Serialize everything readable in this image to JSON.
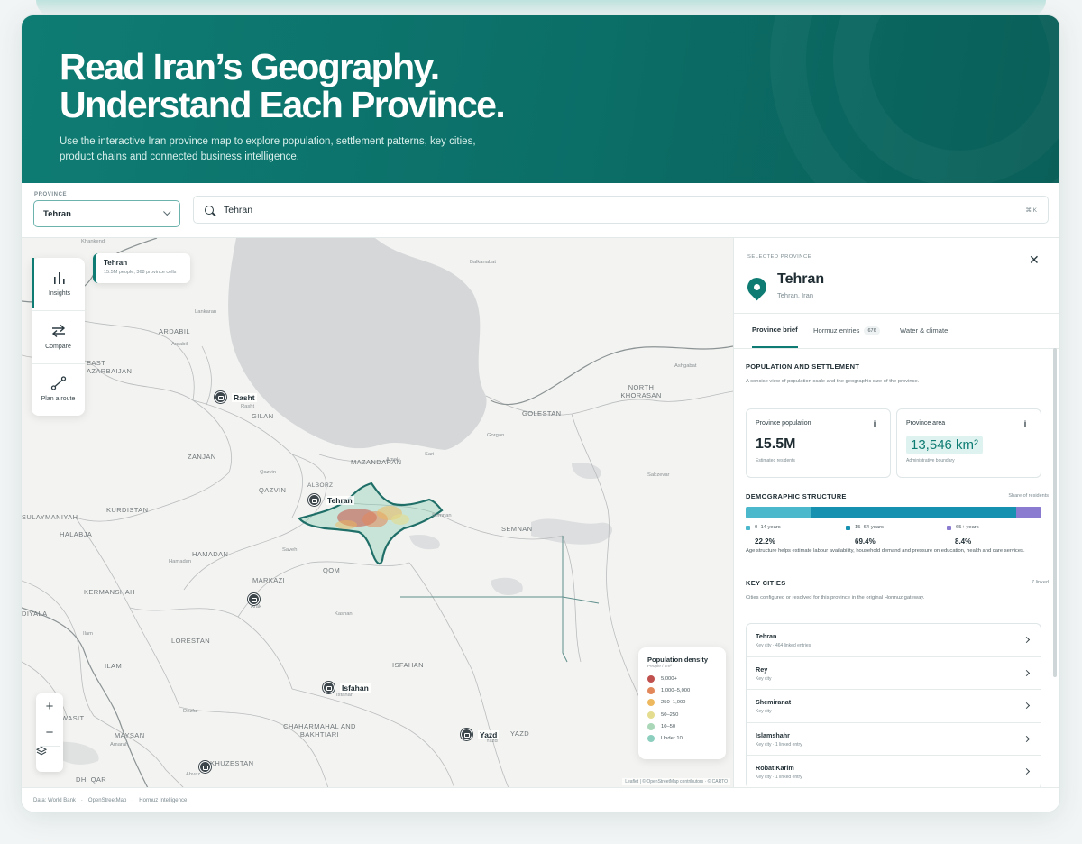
{
  "hero": {
    "title_line1": "Read Iran’s Geography.",
    "title_line2": "Understand Each Province.",
    "description": "Use the interactive Iran province map to explore population, settlement patterns, key cities, product chains and connected business intelligence."
  },
  "controls": {
    "province_label": "PROVINCE",
    "province_value": "Tehran",
    "search_value": "Tehran",
    "search_shortcut": "⌘ K"
  },
  "map": {
    "tools": [
      {
        "label": "Insights",
        "icon": "bar-chart-icon"
      },
      {
        "label": "Compare",
        "icon": "swap-arrows-icon"
      },
      {
        "label": "Plan a route",
        "icon": "route-icon"
      }
    ],
    "tooltip": {
      "title": "Tehran",
      "subtitle": "15.5M people, 368 province cells"
    },
    "regions": [
      "EAST AZARBAIJAN",
      "ARDABIL",
      "GILAN",
      "ZANJAN",
      "QAZVIN",
      "ALBORZ",
      "MAZANDARAN",
      "GOLESTAN",
      "NORTH KHORASAN",
      "KURDISTAN",
      "HAMADAN",
      "MARKAZI",
      "QOM",
      "SEMNAN",
      "KERMANSHAH",
      "LORESTAN",
      "ILAM",
      "ISFAHAN",
      "CHAHARMAHAL AND BAKHTIARI",
      "KHUZESTAN",
      "YAZD",
      "MAYSAN",
      "DHI QAR",
      "SULAYMANIYAH",
      "HALABJA",
      "DIYALA",
      "WASIT"
    ],
    "towns": [
      "Khankendi",
      "Lankaran",
      "Ardabil",
      "Rasht",
      "Balkanabat",
      "Ashgabat",
      "Gorgan",
      "Sari",
      "Amol",
      "Qazvin",
      "Semnan",
      "Sabzevar",
      "Saveh",
      "Hamadan",
      "Arak",
      "Kashan",
      "Ilam",
      "Dezful",
      "Isfahan",
      "Amarah",
      "Ahvaz",
      "Yazd"
    ],
    "labeled_cities": [
      "Rasht",
      "Tehran",
      "Isfahan",
      "Yazd"
    ],
    "zoom_in": "+",
    "zoom_out": "−",
    "legend": {
      "title": "Population density",
      "subtitle": "People / km²",
      "items": [
        {
          "label": "5,000+",
          "color": "#c0504d"
        },
        {
          "label": "1,000–5,000",
          "color": "#e2875a"
        },
        {
          "label": "250–1,000",
          "color": "#edb85e"
        },
        {
          "label": "50–250",
          "color": "#e4dc8e"
        },
        {
          "label": "10–50",
          "color": "#a9d7b8"
        },
        {
          "label": "Under 10",
          "color": "#8dcfbf"
        }
      ]
    },
    "attribution": "Leaflet | © OpenStreetMap contributors · © CARTO"
  },
  "panel": {
    "selected_label": "SELECTED PROVINCE",
    "title": "Tehran",
    "subtitle": "Tehran, Iran",
    "tabs": [
      {
        "label": "Province brief"
      },
      {
        "label": "Hormuz entries",
        "badge": "676"
      },
      {
        "label": "Water & climate"
      }
    ],
    "population": {
      "title": "POPULATION AND SETTLEMENT",
      "desc": "A concise view of population scale and the geographic size of the province.",
      "pop_label": "Province population",
      "pop_value": "15.5M",
      "pop_note": "Estimated residents",
      "area_label": "Province area",
      "area_value": "13,546 km²",
      "area_note": "Administrative boundary"
    },
    "demographics": {
      "title": "DEMOGRAPHIC STRUCTURE",
      "source": "Share of residents",
      "groups": [
        {
          "label": "0–14 years",
          "value": "22.2%",
          "share": 22.2,
          "color": "#4cb8cc"
        },
        {
          "label": "15–64 years",
          "value": "69.4%",
          "share": 69.4,
          "color": "#1691b0"
        },
        {
          "label": "65+ years",
          "value": "8.4%",
          "share": 8.4,
          "color": "#8a7ad0"
        }
      ],
      "note": "Age structure helps estimate labour availability, household demand and pressure on education, health and care services."
    },
    "cities": {
      "title": "KEY CITIES",
      "count": "7 linked",
      "desc": "Cities configured or resolved for this province in the original Hormuz gateway.",
      "items": [
        {
          "name": "Tehran",
          "sub": "Key city · 464 linked entries"
        },
        {
          "name": "Rey",
          "sub": "Key city"
        },
        {
          "name": "Shemiranat",
          "sub": "Key city"
        },
        {
          "name": "Islamshahr",
          "sub": "Key city · 1 linked entry"
        },
        {
          "name": "Robat Karim",
          "sub": "Key city · 1 linked entry"
        }
      ]
    }
  },
  "footer": {
    "items": [
      "Data: World Bank",
      "OpenStreetMap",
      "Hormuz Intelligence"
    ]
  }
}
